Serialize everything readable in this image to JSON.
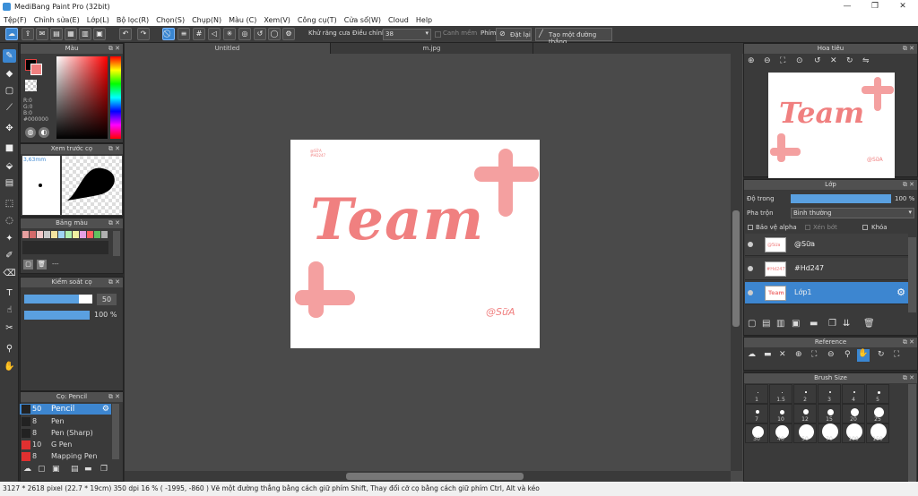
{
  "app": {
    "title": "MediBang Paint Pro (32bit)"
  },
  "menu": [
    "Tệp(F)",
    "Chỉnh sửa(E)",
    "Lớp(L)",
    "Bộ lọc(R)",
    "Chọn(S)",
    "Chụp(N)",
    "Màu (C)",
    "Xem(V)",
    "Công cụ(T)",
    "Cửa sổ(W)",
    "Cloud",
    "Help"
  ],
  "toolbar": {
    "antialias": "Khử răng cưa",
    "adjust_label": "Điều chỉnh",
    "adjust_value": "38",
    "smooth": "Canh mềm",
    "key_label": "Phím",
    "reset": "Đặt lại",
    "straight_line": "Tạo một đường thẳng"
  },
  "color_panel": {
    "title": "Màu",
    "r": "R:0",
    "g": "G:0",
    "b": "B:0",
    "hex": "#000000"
  },
  "brush_preview": {
    "title": "Xem trước cọ",
    "size": "3,63mm"
  },
  "palette": {
    "title": "Bảng màu",
    "value": "---",
    "colors": [
      "#e8a0a0",
      "#d46a6a",
      "#f0c8c8",
      "#c8c8c8",
      "#f4e4a0",
      "#a0d4f4",
      "#b0f0b0",
      "#f0f0a0",
      "#e4a0e4",
      "#ff6060",
      "#60c060",
      "#b0b0b0"
    ]
  },
  "brush_control": {
    "title": "Kiểm soát cọ",
    "size": "50",
    "opacity": "100 %",
    "size_fill": 0.8,
    "opacity_fill": 1.0
  },
  "brush_list": {
    "title": "Cọ: Pencil",
    "items": [
      {
        "n": "50",
        "t": "Pencil",
        "c": "#222"
      },
      {
        "n": "8",
        "t": "Pen",
        "c": "#222"
      },
      {
        "n": "8",
        "t": "Pen (Sharp)",
        "c": "#222"
      },
      {
        "n": "10",
        "t": "G Pen",
        "c": "#e03030"
      },
      {
        "n": "8",
        "t": "Mapping Pen",
        "c": "#e03030"
      }
    ]
  },
  "tabs": [
    "Untitled",
    "m.jpg"
  ],
  "artwork": {
    "title": "Team",
    "small_text_1": "@SỮA",
    "small_text_2": "#HD247",
    "signature": "@SữA",
    "color": "#f08080"
  },
  "navigator": {
    "title": "Hoa tiêu"
  },
  "layer_panel": {
    "title": "Lớp",
    "opacity_label": "Độ trong",
    "opacity_value": "100 %",
    "opacity_fill": 1.0,
    "blend_label": "Pha trộn",
    "blend_value": "Bình thường",
    "protect_alpha": "Bảo vệ alpha",
    "clip": "Xén bớt",
    "lock": "Khóa",
    "layers": [
      {
        "name": "@Sữa",
        "thumb": "@Sữa"
      },
      {
        "name": "#Hd247",
        "thumb": "#Hd247"
      },
      {
        "name": "Lớp1",
        "thumb": "Team"
      }
    ]
  },
  "reference": {
    "title": "Reference"
  },
  "brush_size": {
    "title": "Brush Size",
    "labels": [
      "1",
      "1.5",
      "2",
      "3",
      "4",
      "5",
      "7",
      "10",
      "12",
      "15",
      "20",
      "25",
      "30",
      "40",
      "50",
      "70",
      "100",
      "150"
    ]
  },
  "status": {
    "text": "3127 * 2618 pixel   (22.7 * 19cm)   350 dpi   16 %   ( -1995, -860 )   Vẽ một đường thẳng bằng cách giữ phím Shift, Thay đổi cỡ cọ bằng cách giữ phím Ctrl, Alt và kéo"
  }
}
